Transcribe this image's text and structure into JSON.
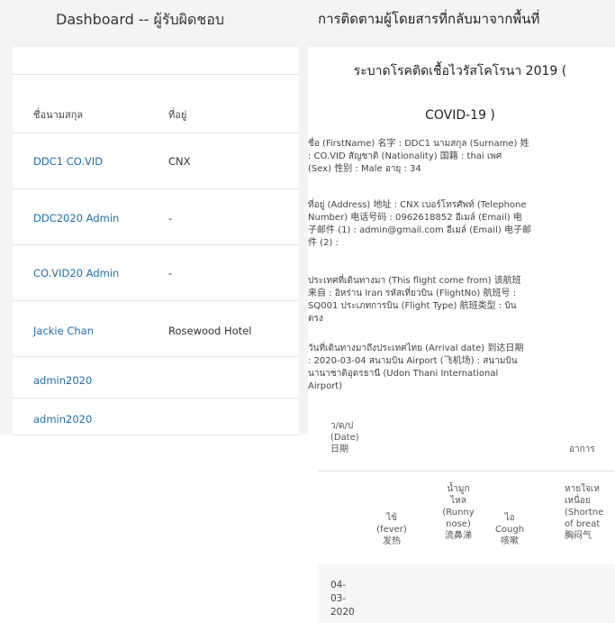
{
  "header": {
    "dashboard_title": "Dashboard -- ผู้รับผิดชอบ",
    "page_heading": "การติดตามผู้โดยสารที่กลับมาจากพื้นที่"
  },
  "left_table": {
    "col_name": "ชื่อนามสกุล",
    "col_address": "ที่อยู่",
    "rows": [
      {
        "name": "DDC1 CO.VID",
        "address": "CNX"
      },
      {
        "name": "DDC2020 Admin",
        "address": "-"
      },
      {
        "name": "CO.VID20 Admin",
        "address": "-"
      },
      {
        "name": "Jackie Chan",
        "address": "Rosewood Hotel"
      },
      {
        "name": "admin2020",
        "address": ""
      },
      {
        "name": "admin2020",
        "address": ""
      }
    ]
  },
  "modal": {
    "heading_line1": "ระบาดโรคติดเชื้อไวรัสโคโรนา 2019 (",
    "heading_line2": "COVID-19 )",
    "info": {
      "name_line1": "ชื่อ (FirstName) 名字 : DDC1 นามสกุล (Surname) 姓",
      "name_line2": ": CO.VID สัญชาติ (Nationality) 国籍 : thai เพศ",
      "name_line3": "(Sex) 性别 : Male อายุ : 34",
      "addr_line1": "ที่อยู่ (Address) 地址 : CNX เบอร์โทรศัพท์ (Telephone",
      "addr_line2": "Number) 电话号码 : 0962618852 อีเมล์ (Email) 电",
      "addr_line3": "子邮件 (1) : admin@gmail.com อีเมล์ (Email) 电子邮",
      "addr_line4": "件 (2) :",
      "flight_line1": "ประเทศที่เดินทางมา (This flight come from) 该航班",
      "flight_line2": "来自 : อิหร่าน Iran รหัสเที่ยวบิน (FlightNo) 航班号 :",
      "flight_line3": "SQ001 ประเภทการบิน (Flight Type) 航班类型 : บิน",
      "flight_line4": "ตรง",
      "arrival_line1": "วันที่เดินทางมาถึงประเทศไทย (Arrival date) 到达日期",
      "arrival_line2": ": 2020-03-04 สนามบิน Airport (飞机场) : สนามบิน",
      "arrival_line3": "นานาชาติอุดรธานี (Udon Thani International",
      "arrival_line4": "Airport)"
    },
    "table": {
      "date_line1": "ว/ด/ป",
      "date_line2": "(Date)",
      "date_line3": "日期",
      "symptoms_label": "อาการ",
      "fever_line1": "ไข้",
      "fever_line2": "(fever)",
      "fever_line3": "发热",
      "runny_line1": "น้ำมูก",
      "runny_line2": "ไหล",
      "runny_line3": "(Runny",
      "runny_line4": "nose)",
      "runny_line5": "流鼻涕",
      "cough_line1": "ไอ",
      "cough_line2": "Cough",
      "cough_line3": "咳嗽",
      "breath_line1": "หายใจเห",
      "breath_line2": "เหนื่อย",
      "breath_line3": "(Shortne",
      "breath_line4": "of breat",
      "breath_line5": "胸闷气",
      "row_date_line1": "04-",
      "row_date_line2": "03-",
      "row_date_line3": "2020"
    }
  }
}
